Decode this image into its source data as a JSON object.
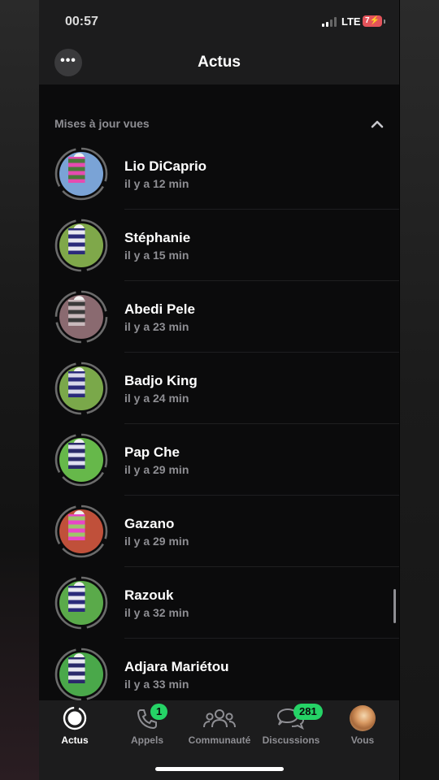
{
  "status": {
    "time": "00:57",
    "network": "LTE",
    "battery": "7"
  },
  "header": {
    "title": "Actus",
    "more_icon": "ellipsis-icon"
  },
  "section": {
    "title": "Mises à jour vues",
    "toggle_icon": "chevron-up-icon"
  },
  "updates": [
    {
      "name": "Lio DiCaprio",
      "time": "il y a 12 min"
    },
    {
      "name": "Stéphanie",
      "time": "il y a 15 min"
    },
    {
      "name": "Abedi Pele",
      "time": "il y a 23 min"
    },
    {
      "name": "Badjo King",
      "time": "il y a 24 min"
    },
    {
      "name": "Pap Che",
      "time": "il y a 29 min"
    },
    {
      "name": "Gazano",
      "time": "il y a 29 min"
    },
    {
      "name": "Razouk",
      "time": "il y a 32 min"
    },
    {
      "name": "Adjara Mariétou",
      "time": "il y a 33 min"
    }
  ],
  "tabs": [
    {
      "label": "Actus",
      "icon": "status-icon",
      "badge": ""
    },
    {
      "label": "Appels",
      "icon": "phone-icon",
      "badge": "1"
    },
    {
      "label": "Communauté",
      "icon": "community-icon",
      "badge": ""
    },
    {
      "label": "Discussions",
      "icon": "chats-icon",
      "badge": "281"
    },
    {
      "label": "Vous",
      "icon": "profile-avatar",
      "badge": ""
    }
  ],
  "colors": {
    "accent": "#25d366",
    "ring": "#6b6b6b",
    "background": "#0b0b0c"
  }
}
